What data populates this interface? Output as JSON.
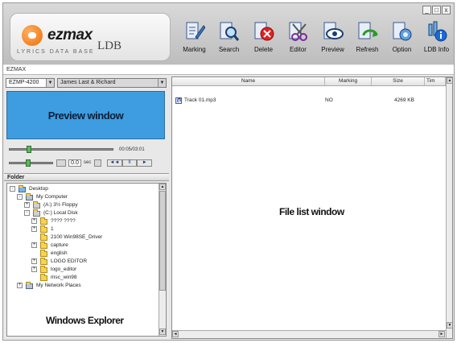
{
  "app": {
    "logo_text": "ezmax",
    "logo_subtext": "LYRICS DATA BASE",
    "logo_ldb": "LDB",
    "window_title": "EZMAX",
    "window_controls": [
      "_",
      "□",
      "x"
    ]
  },
  "toolbar": {
    "items": [
      {
        "label": "Marking",
        "icon": "marking-icon"
      },
      {
        "label": "Search",
        "icon": "search-icon"
      },
      {
        "label": "Delete",
        "icon": "delete-icon"
      },
      {
        "label": "Editor",
        "icon": "editor-icon"
      },
      {
        "label": "Preview",
        "icon": "preview-icon"
      },
      {
        "label": "Refresh",
        "icon": "refresh-icon"
      },
      {
        "label": "Option",
        "icon": "option-icon"
      },
      {
        "label": "LDB Info",
        "icon": "info-icon"
      }
    ]
  },
  "player": {
    "device": "EZMP-4200",
    "playlist": "James Last & Richard",
    "preview_label": "Preview window",
    "time": "00:05/03:01",
    "speed_value": "0.0",
    "speed_unit": "sec",
    "transport": [
      "◄◄",
      "II",
      "►"
    ]
  },
  "folder": {
    "header": "Folder",
    "tree": [
      {
        "label": "Desktop",
        "depth": 0,
        "toggle": "-"
      },
      {
        "label": "My Computer",
        "depth": 1,
        "toggle": "-"
      },
      {
        "label": "(A:) 3½ Floppy",
        "depth": 2,
        "toggle": "+"
      },
      {
        "label": "(C:) Local Disk",
        "depth": 2,
        "toggle": "-"
      },
      {
        "label": "???? ????",
        "depth": 3,
        "toggle": "+"
      },
      {
        "label": "1",
        "depth": 3,
        "toggle": "+"
      },
      {
        "label": "2100 Win98SE_Driver",
        "depth": 3,
        "toggle": ""
      },
      {
        "label": "capture",
        "depth": 3,
        "toggle": "+"
      },
      {
        "label": "english",
        "depth": 3,
        "toggle": ""
      },
      {
        "label": "LOGO EDITOR",
        "depth": 3,
        "toggle": "+"
      },
      {
        "label": "logo_editor",
        "depth": 3,
        "toggle": "+"
      },
      {
        "label": "msc_win98",
        "depth": 3,
        "toggle": ""
      },
      {
        "label": "My Network Places",
        "depth": 1,
        "toggle": "+"
      }
    ],
    "explorer_label": "Windows Explorer"
  },
  "file_list": {
    "columns": [
      {
        "label": "Name"
      },
      {
        "label": "Marking"
      },
      {
        "label": "Size"
      },
      {
        "label": "Tim"
      }
    ],
    "rows": [
      {
        "name": "Track 01.mp3",
        "marking": "NO",
        "size": "4269 KB"
      }
    ],
    "window_label": "File list window"
  },
  "colors": {
    "preview": "#3d9de0",
    "logo_orange": "#ef6d00",
    "folder_yellow": "#f4d451",
    "knob_green": "#5ab85a"
  }
}
